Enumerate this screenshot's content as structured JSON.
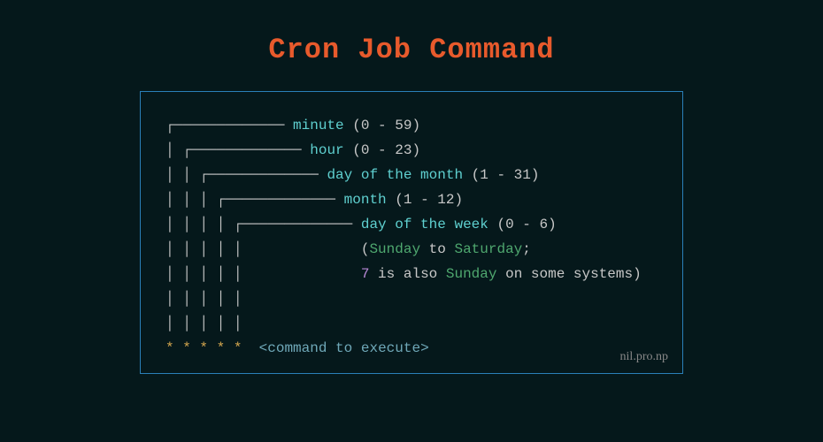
{
  "title": "Cron Job Command",
  "fields": [
    {
      "label": "minute",
      "range": "(0 - 59)"
    },
    {
      "label": "hour",
      "range": "(0 - 23)"
    },
    {
      "label": "day of the month",
      "range": "(1 - 31)"
    },
    {
      "label": "month",
      "range": "(1 - 12)"
    },
    {
      "label": "day of the week",
      "range": "(0 - 6)"
    }
  ],
  "note_open": "(",
  "note_sun": "Sunday",
  "note_to": " to ",
  "note_sat": "Saturday",
  "note_semi": ";",
  "note_seven": "7",
  "note_mid": " is also ",
  "note_sun2": "Sunday",
  "note_rest": " on some systems)",
  "stars": "* * * * *",
  "cmd_open": "<",
  "cmd_word": "command",
  "cmd_to": " to ",
  "cmd_exec": "execute",
  "cmd_close": ">",
  "attribution": "nil.pro.np"
}
